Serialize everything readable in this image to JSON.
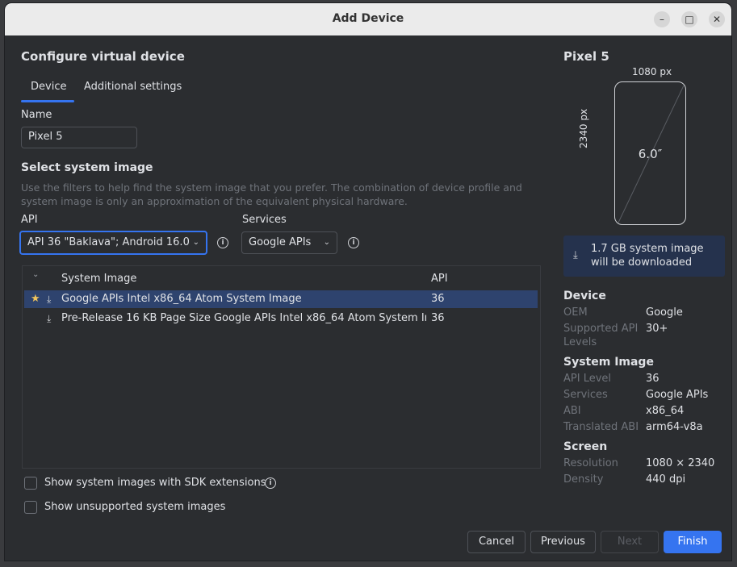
{
  "window": {
    "title": "Add Device",
    "minimize_glyph": "–",
    "maximize_glyph": "□",
    "close_glyph": "✕"
  },
  "left": {
    "heading": "Configure virtual device",
    "tabs": [
      {
        "label": "Device",
        "active": true
      },
      {
        "label": "Additional settings",
        "active": false
      }
    ],
    "name_label": "Name",
    "name_value": "Pixel 5",
    "system_image_heading": "Select system image",
    "system_image_hint": "Use the filters to help find the system image that you prefer. The combination of device profile and system image is only an approximation of the equivalent physical hardware.",
    "api_label": "API",
    "api_value": "API 36 \"Baklava\"; Android 16.0",
    "services_label": "Services",
    "services_value": "Google APIs",
    "table": {
      "columns": [
        "System Image",
        "API"
      ],
      "rows": [
        {
          "name": "Google APIs Intel x86_64 Atom System Image",
          "api": "36",
          "starred": true,
          "selected": true
        },
        {
          "name": "Pre-Release 16 KB Page Size Google APIs Intel x86_64 Atom System Im...",
          "api": "36",
          "starred": false,
          "selected": false
        }
      ]
    },
    "checkbox_sdk_ext": "Show system images with SDK extensions",
    "checkbox_unsupported": "Show unsupported system images"
  },
  "right": {
    "device_name": "Pixel 5",
    "width_px": "1080 px",
    "height_px": "2340 px",
    "diagonal": "6.0″",
    "download_notice": "1.7 GB system image will be downloaded",
    "device_section": "Device",
    "oem_label": "OEM",
    "oem_value": "Google",
    "supported_api_label_1": "Supported API",
    "supported_api_label_2": "Levels",
    "supported_api_value": "30+",
    "system_image_section": "System Image",
    "api_level_label": "API Level",
    "api_level_value": "36",
    "services_label": "Services",
    "services_value": "Google APIs",
    "abi_label": "ABI",
    "abi_value": "x86_64",
    "translated_abi_label": "Translated ABI",
    "translated_abi_value": "arm64-v8a",
    "screen_section": "Screen",
    "resolution_label": "Resolution",
    "resolution_value": "1080 × 2340",
    "density_label": "Density",
    "density_value": "440 dpi"
  },
  "buttons": {
    "cancel": "Cancel",
    "previous": "Previous",
    "next": "Next",
    "finish": "Finish"
  },
  "colors": {
    "background": "#2b2d30",
    "accent": "#3574f0",
    "selection": "#2e436e",
    "star": "#f2c55c"
  }
}
